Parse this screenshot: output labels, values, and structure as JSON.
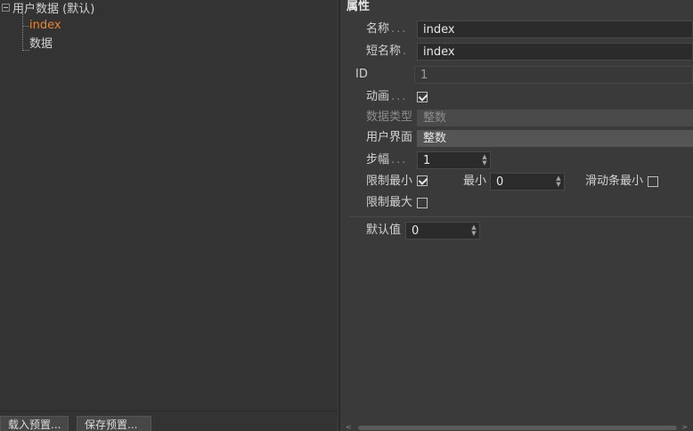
{
  "tree": {
    "root_label": "用户数据 (默认)",
    "children": [
      {
        "label": "index",
        "selected": true
      },
      {
        "label": "数据",
        "selected": false
      }
    ]
  },
  "footer": {
    "load_preset": "载入预置...",
    "save_preset": "保存预置..."
  },
  "properties": {
    "title": "属性",
    "name": {
      "label": "名称",
      "value": "index"
    },
    "short_name": {
      "label": "短名称",
      "value": "index"
    },
    "id": {
      "label": "ID",
      "value": "1"
    },
    "animation": {
      "label": "动画",
      "checked": true
    },
    "data_type": {
      "label": "数据类型",
      "value": "整数"
    },
    "user_interface": {
      "label": "用户界面",
      "value": "整数"
    },
    "step": {
      "label": "步幅",
      "value": "1"
    },
    "limit_min": {
      "label": "限制最小",
      "checked": true
    },
    "min": {
      "label": "最小",
      "value": "0"
    },
    "slider_min": {
      "label": "滑动条最小",
      "checked": false
    },
    "limit_max": {
      "label": "限制最大",
      "checked": false
    },
    "default_value": {
      "label": "默认值",
      "value": "0"
    }
  },
  "colors": {
    "selected_text": "#e8862b",
    "panel_bg": "#3a3a3a",
    "tree_bg": "#333333"
  }
}
